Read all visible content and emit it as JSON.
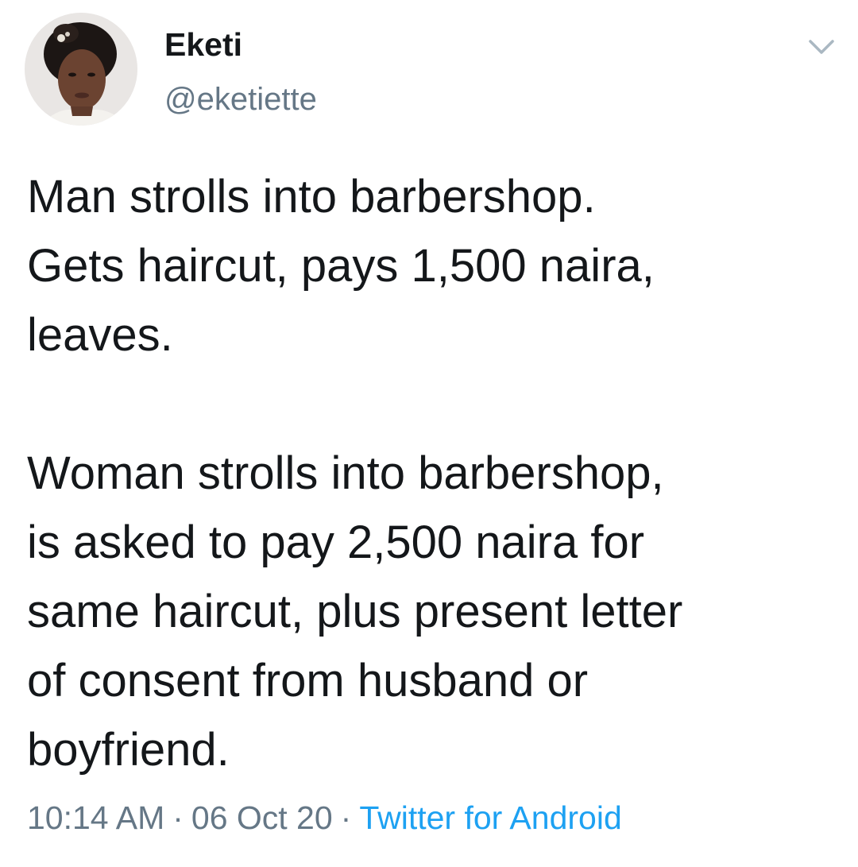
{
  "author": {
    "display_name": "Eketi",
    "handle": "@eketiette"
  },
  "tweet": {
    "paragraph1": [
      "Man strolls into barbershop.",
      "Gets haircut, pays 1,500 naira,",
      "leaves."
    ],
    "paragraph2": [
      "Woman strolls into barbershop,",
      "is asked to pay 2,500 naira for",
      "same haircut, plus present letter",
      "of consent from husband or",
      "boyfriend."
    ]
  },
  "meta": {
    "time": "10:14 AM",
    "separator": "·",
    "date": "06 Oct 20",
    "source": "Twitter for Android"
  },
  "icons": {
    "menu": "chevron-down-icon",
    "avatar": "profile-photo"
  },
  "colors": {
    "text": "#14171a",
    "secondary": "#657786",
    "link": "#1da1f2"
  }
}
